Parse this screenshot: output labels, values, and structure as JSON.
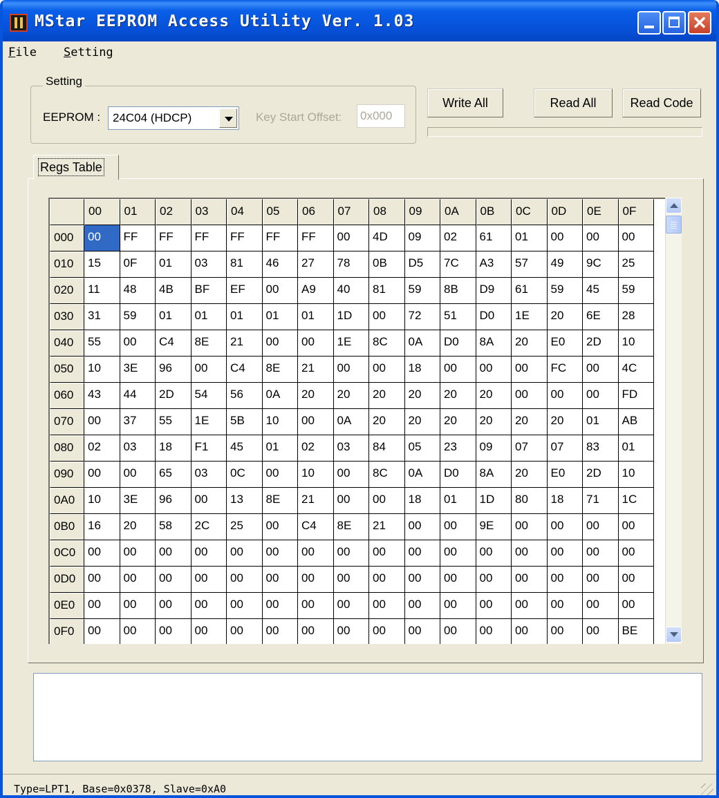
{
  "window": {
    "title": "MStar EEPROM Access Utility Ver. 1.03"
  },
  "menu": [
    {
      "accel": "F",
      "rest": "ile"
    },
    {
      "accel": "S",
      "rest": "etting"
    }
  ],
  "setting": {
    "group_label": "Setting",
    "eeprom_label": "EEPROM :",
    "eeprom_value": "24C04 (HDCP)",
    "key_offset_label": "Key Start Offset:",
    "key_offset_value": "0x000"
  },
  "buttons": {
    "write_all": "Write All",
    "read_all": "Read All",
    "read_code": "Read Code"
  },
  "tabs": [
    {
      "label": "Regs Table"
    }
  ],
  "regs": {
    "columns": [
      "00",
      "01",
      "02",
      "03",
      "04",
      "05",
      "06",
      "07",
      "08",
      "09",
      "0A",
      "0B",
      "0C",
      "0D",
      "0E",
      "0F"
    ],
    "selected": {
      "row": 0,
      "col": 0
    },
    "rows": [
      {
        "addr": "000",
        "cells": [
          "00",
          "FF",
          "FF",
          "FF",
          "FF",
          "FF",
          "FF",
          "00",
          "4D",
          "09",
          "02",
          "61",
          "01",
          "00",
          "00",
          "00"
        ]
      },
      {
        "addr": "010",
        "cells": [
          "15",
          "0F",
          "01",
          "03",
          "81",
          "46",
          "27",
          "78",
          "0B",
          "D5",
          "7C",
          "A3",
          "57",
          "49",
          "9C",
          "25"
        ]
      },
      {
        "addr": "020",
        "cells": [
          "11",
          "48",
          "4B",
          "BF",
          "EF",
          "00",
          "A9",
          "40",
          "81",
          "59",
          "8B",
          "D9",
          "61",
          "59",
          "45",
          "59"
        ]
      },
      {
        "addr": "030",
        "cells": [
          "31",
          "59",
          "01",
          "01",
          "01",
          "01",
          "01",
          "1D",
          "00",
          "72",
          "51",
          "D0",
          "1E",
          "20",
          "6E",
          "28"
        ]
      },
      {
        "addr": "040",
        "cells": [
          "55",
          "00",
          "C4",
          "8E",
          "21",
          "00",
          "00",
          "1E",
          "8C",
          "0A",
          "D0",
          "8A",
          "20",
          "E0",
          "2D",
          "10"
        ]
      },
      {
        "addr": "050",
        "cells": [
          "10",
          "3E",
          "96",
          "00",
          "C4",
          "8E",
          "21",
          "00",
          "00",
          "18",
          "00",
          "00",
          "00",
          "FC",
          "00",
          "4C"
        ]
      },
      {
        "addr": "060",
        "cells": [
          "43",
          "44",
          "2D",
          "54",
          "56",
          "0A",
          "20",
          "20",
          "20",
          "20",
          "20",
          "20",
          "00",
          "00",
          "00",
          "FD"
        ]
      },
      {
        "addr": "070",
        "cells": [
          "00",
          "37",
          "55",
          "1E",
          "5B",
          "10",
          "00",
          "0A",
          "20",
          "20",
          "20",
          "20",
          "20",
          "20",
          "01",
          "AB"
        ]
      },
      {
        "addr": "080",
        "cells": [
          "02",
          "03",
          "18",
          "F1",
          "45",
          "01",
          "02",
          "03",
          "84",
          "05",
          "23",
          "09",
          "07",
          "07",
          "83",
          "01"
        ]
      },
      {
        "addr": "090",
        "cells": [
          "00",
          "00",
          "65",
          "03",
          "0C",
          "00",
          "10",
          "00",
          "8C",
          "0A",
          "D0",
          "8A",
          "20",
          "E0",
          "2D",
          "10"
        ]
      },
      {
        "addr": "0A0",
        "cells": [
          "10",
          "3E",
          "96",
          "00",
          "13",
          "8E",
          "21",
          "00",
          "00",
          "18",
          "01",
          "1D",
          "80",
          "18",
          "71",
          "1C"
        ]
      },
      {
        "addr": "0B0",
        "cells": [
          "16",
          "20",
          "58",
          "2C",
          "25",
          "00",
          "C4",
          "8E",
          "21",
          "00",
          "00",
          "9E",
          "00",
          "00",
          "00",
          "00"
        ]
      },
      {
        "addr": "0C0",
        "cells": [
          "00",
          "00",
          "00",
          "00",
          "00",
          "00",
          "00",
          "00",
          "00",
          "00",
          "00",
          "00",
          "00",
          "00",
          "00",
          "00"
        ]
      },
      {
        "addr": "0D0",
        "cells": [
          "00",
          "00",
          "00",
          "00",
          "00",
          "00",
          "00",
          "00",
          "00",
          "00",
          "00",
          "00",
          "00",
          "00",
          "00",
          "00"
        ]
      },
      {
        "addr": "0E0",
        "cells": [
          "00",
          "00",
          "00",
          "00",
          "00",
          "00",
          "00",
          "00",
          "00",
          "00",
          "00",
          "00",
          "00",
          "00",
          "00",
          "00"
        ]
      },
      {
        "addr": "0F0",
        "cells": [
          "00",
          "00",
          "00",
          "00",
          "00",
          "00",
          "00",
          "00",
          "00",
          "00",
          "00",
          "00",
          "00",
          "00",
          "00",
          "BE"
        ]
      },
      {
        "addr": "",
        "cells": [
          "",
          "",
          "",
          "",
          "",
          "",
          "",
          "",
          "",
          "",
          "",
          "",
          "",
          "",
          "",
          ""
        ]
      }
    ]
  },
  "output": {
    "text": ""
  },
  "status": {
    "text": "Type=LPT1, Base=0x0378, Slave=0xA0"
  },
  "colors": {
    "title_bar": "#0a5fe8",
    "selection": "#316ac5",
    "window_bg": "#ece9d8"
  },
  "icons": {
    "app": "mstar-logo-icon",
    "minimize": "minimize-icon",
    "maximize": "maximize-icon",
    "close": "close-icon"
  }
}
